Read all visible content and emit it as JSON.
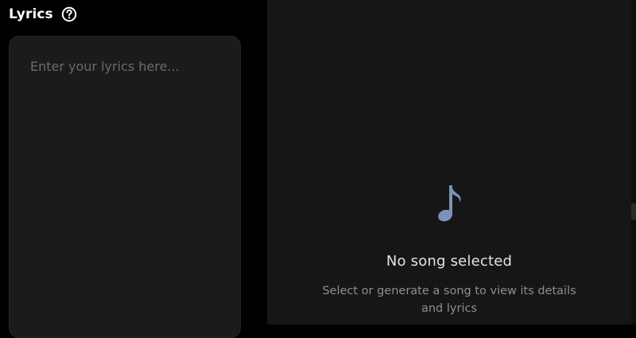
{
  "lyrics_panel": {
    "title": "Lyrics",
    "help_icon": "question-circle-icon",
    "textarea": {
      "placeholder": "Enter your lyrics here...",
      "value": ""
    }
  },
  "song_panel": {
    "icon": "music-note-icon",
    "icon_color": "#7b93b8",
    "empty_title": "No song selected",
    "empty_subtitle": "Select or generate a song to view its details and lyrics"
  }
}
